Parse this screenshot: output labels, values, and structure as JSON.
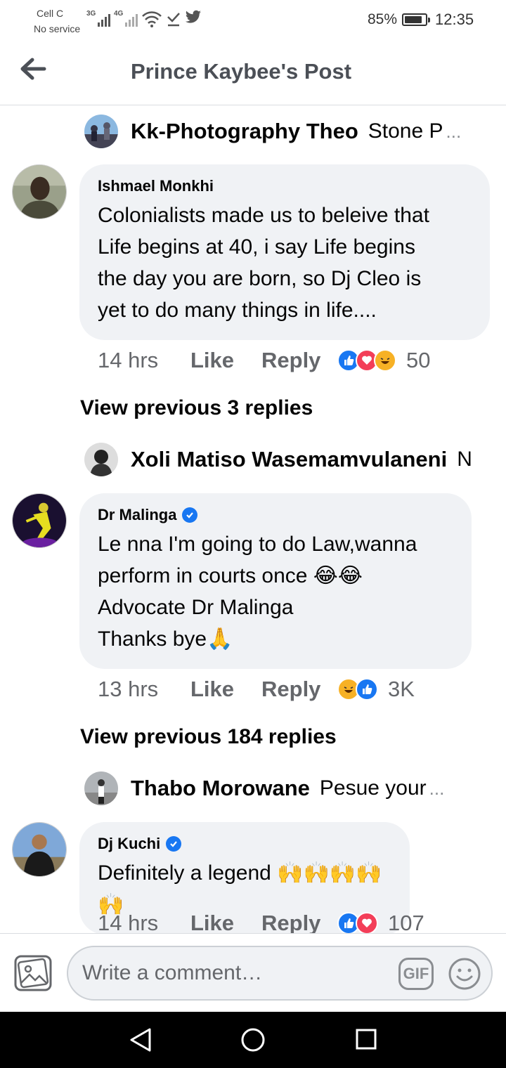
{
  "status_bar": {
    "carrier": "Cell C",
    "carrier_status": "No service",
    "sim1_type": "3G",
    "sim2_type": "4G",
    "battery": "85%",
    "battery_level": 0.85,
    "time": "12:35"
  },
  "header": {
    "title": "Prince Kaybee's Post"
  },
  "feed": {
    "reply1": {
      "name": "Kk-Photography Theo",
      "text": "Stone P",
      "ellipsis": "..."
    },
    "comment1": {
      "name": "Ishmael Monkhi",
      "text": "Colonialists made us to beleive that\nLife begins at 40, i say Life begins\nthe day you are born, so Dj Cleo is\nyet to do many things in life....",
      "time": "14 hrs",
      "like": "Like",
      "reply": "Reply",
      "reaction_count": "50",
      "reactions": [
        "like-reaction",
        "love-reaction",
        "haha-reaction"
      ]
    },
    "view_prev_1": "View previous 3 replies",
    "reply2": {
      "name": "Xoli Matiso Wasemamvulaneni",
      "text": "N"
    },
    "comment2": {
      "name": "Dr Malinga",
      "verified": true,
      "text": "Le nna I'm going to do Law,wanna\nperform in courts once 😂😂\nAdvocate Dr Malinga\nThanks bye🙏",
      "time": "13 hrs",
      "like": "Like",
      "reply": "Reply",
      "reaction_count": "3K",
      "reactions": [
        "haha-reaction",
        "like-reaction"
      ]
    },
    "view_prev_2": "View previous 184 replies",
    "reply3": {
      "name": "Thabo Morowane",
      "text": "Pesue your",
      "ellipsis": "..."
    },
    "comment3": {
      "name": "Dj Kuchi",
      "verified": true,
      "text": "Definitely a legend 🙌🙌🙌🙌🙌",
      "time": "14 hrs",
      "like": "Like",
      "reply": "Reply",
      "reaction_count": "107",
      "reactions": [
        "like-reaction",
        "love-reaction"
      ]
    }
  },
  "composer": {
    "placeholder": "Write a comment…",
    "gif_label": "GIF"
  },
  "colors": {
    "like_blue": "#1877f2",
    "love_red": "#f33e58",
    "haha_yellow": "#f7b125",
    "bubble_bg": "#f0f2f5"
  }
}
